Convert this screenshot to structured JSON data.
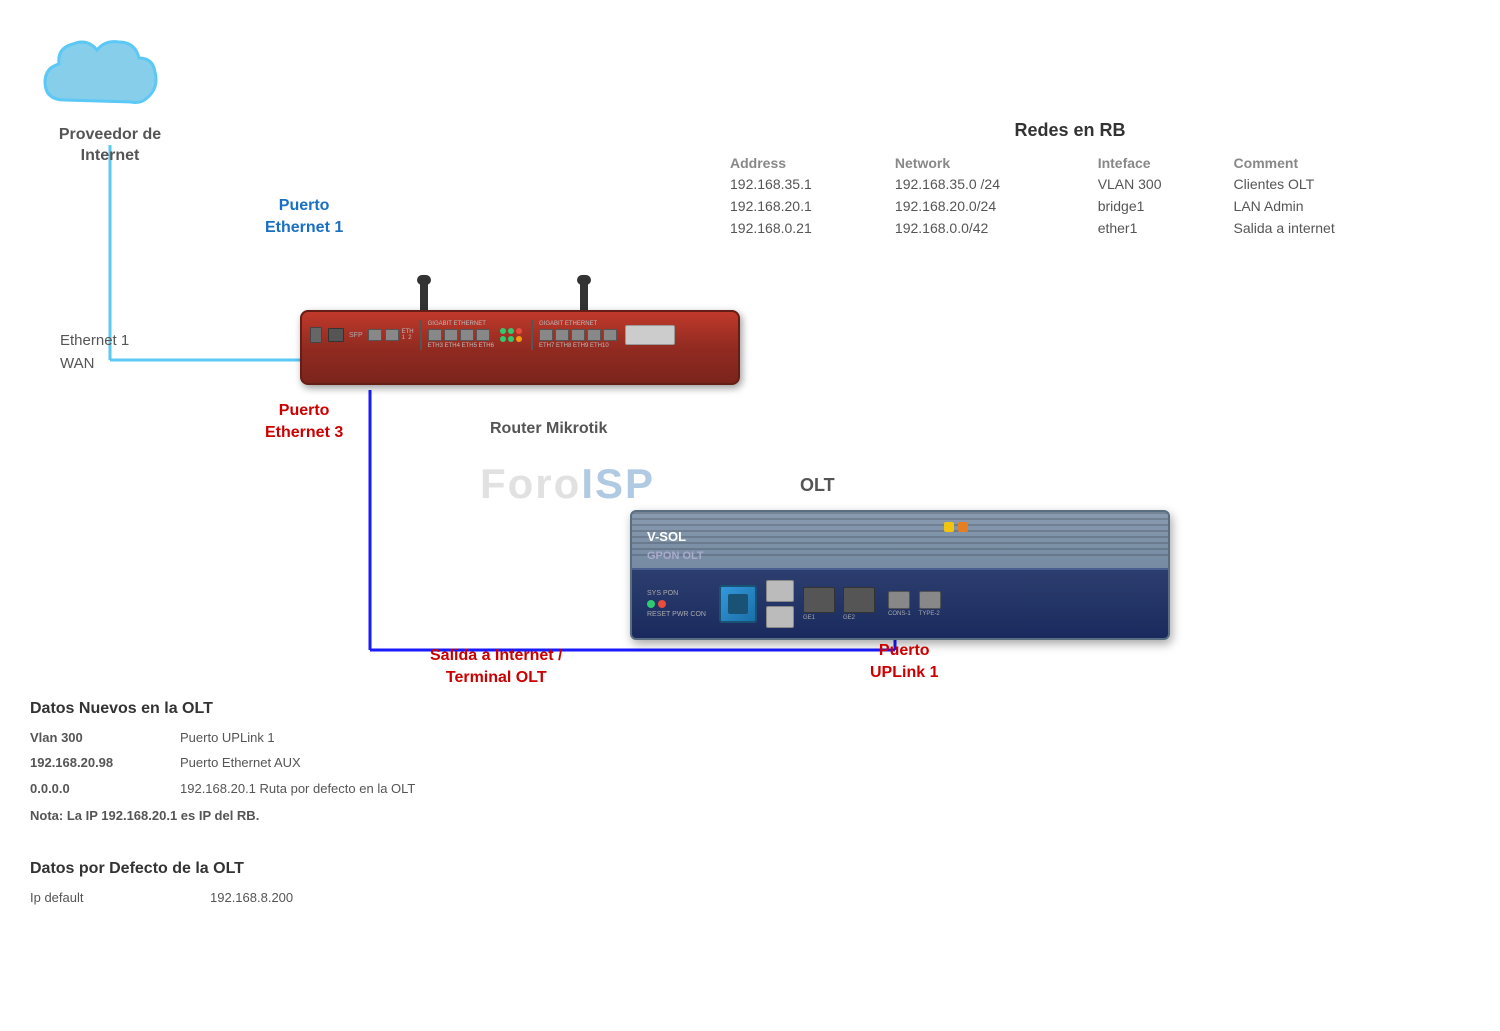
{
  "cloud": {
    "label": "Proveedor de\nInternet"
  },
  "eth1_wan": {
    "line1": "Ethernet 1",
    "line2": "WAN"
  },
  "puerto_eth1": {
    "label": "Puerto\nEthernet 1"
  },
  "puerto_eth3": {
    "label": "Puerto\nEthernet 3"
  },
  "router": {
    "label": "Router Mikrotik"
  },
  "olt": {
    "title": "OLT",
    "brand": "V-SOL",
    "model": "GPON OLT"
  },
  "puerto_uplink": {
    "label": "Puerto\nUPLink 1"
  },
  "salida_internet": {
    "label": "Salida a Internet /\nTerminal OLT"
  },
  "redes_rb": {
    "title": "Redes en RB",
    "headers": {
      "address": "Address",
      "network": "Network",
      "interface": "Inteface",
      "comment": "Comment"
    },
    "rows": [
      {
        "address": "192.168.35.1",
        "network": "192.168.35.0 /24",
        "interface": "VLAN 300",
        "comment": "Clientes OLT"
      },
      {
        "address": "192.168.20.1",
        "network": "192.168.20.0/24",
        "interface": "bridge1",
        "comment": "LAN Admin"
      },
      {
        "address": "192.168.0.21",
        "network": "192.168.0.0/42",
        "interface": "ether1",
        "comment": "Salida a internet"
      }
    ]
  },
  "datos_nuevos": {
    "title": "Datos Nuevos en  la OLT",
    "rows": [
      {
        "col1": "Vlan 300",
        "col2": "Puerto UPLink 1"
      },
      {
        "col1": "192.168.20.98",
        "col2": "Puerto Ethernet AUX"
      },
      {
        "col1": "0.0.0.0",
        "col2": "192.168.20.1    Ruta  por defecto en la OLT"
      }
    ],
    "nota": "Nota: La IP 192.168.20.1 es IP del RB."
  },
  "datos_defecto": {
    "title": "Datos por Defecto de la OLT",
    "rows": [
      {
        "col1": "Ip default",
        "col2": "192.168.8.200"
      }
    ]
  },
  "foroISP": {
    "text": "Foro",
    "isp": "ISP"
  }
}
